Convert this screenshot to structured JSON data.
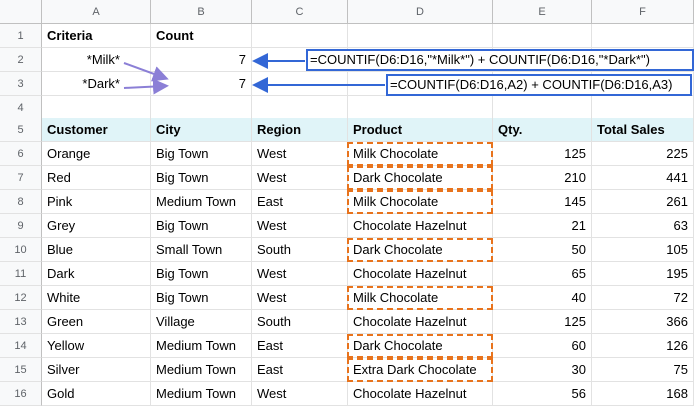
{
  "columns": [
    "A",
    "B",
    "C",
    "D",
    "E",
    "F"
  ],
  "rows": {
    "r1": {
      "num": "1",
      "a": "Criteria",
      "b": "Count"
    },
    "r2": {
      "num": "2",
      "a": "*Milk*",
      "b": "7"
    },
    "r3": {
      "num": "3",
      "a": "*Dark*",
      "b": "7"
    },
    "r4": {
      "num": "4"
    },
    "r5": {
      "num": "5",
      "a": "Customer",
      "b": "City",
      "c": "Region",
      "d": "Product",
      "e": "Qty.",
      "f": "Total Sales"
    },
    "data": [
      {
        "num": "6",
        "a": "Orange",
        "b": "Big Town",
        "c": "West",
        "d": "Milk Chocolate",
        "e": "125",
        "f": "225"
      },
      {
        "num": "7",
        "a": "Red",
        "b": "Big Town",
        "c": "West",
        "d": "Dark Chocolate",
        "e": "210",
        "f": "441"
      },
      {
        "num": "8",
        "a": "Pink",
        "b": "Medium Town",
        "c": "East",
        "d": "Milk Chocolate",
        "e": "145",
        "f": "261"
      },
      {
        "num": "9",
        "a": "Grey",
        "b": "Big Town",
        "c": "West",
        "d": "Chocolate Hazelnut",
        "e": "21",
        "f": "63"
      },
      {
        "num": "10",
        "a": "Blue",
        "b": "Small Town",
        "c": "South",
        "d": "Dark Chocolate",
        "e": "50",
        "f": "105"
      },
      {
        "num": "11",
        "a": "Dark",
        "b": "Big Town",
        "c": "West",
        "d": "Chocolate Hazelnut",
        "e": "65",
        "f": "195"
      },
      {
        "num": "12",
        "a": "White",
        "b": "Big Town",
        "c": "West",
        "d": "Milk Chocolate",
        "e": "40",
        "f": "72"
      },
      {
        "num": "13",
        "a": "Green",
        "b": "Village",
        "c": "South",
        "d": "Chocolate Hazelnut",
        "e": "125",
        "f": "366"
      },
      {
        "num": "14",
        "a": "Yellow",
        "b": "Medium Town",
        "c": "East",
        "d": "Dark Chocolate",
        "e": "60",
        "f": "126"
      },
      {
        "num": "15",
        "a": "Silver",
        "b": "Medium Town",
        "c": "East",
        "d": "Extra Dark Chocolate",
        "e": "30",
        "f": "75"
      },
      {
        "num": "16",
        "a": "Gold",
        "b": "Medium Town",
        "c": "West",
        "d": "Chocolate Hazelnut",
        "e": "56",
        "f": "168"
      }
    ]
  },
  "formulas": {
    "milk": "=COUNTIF(D6:D16,\"*Milk*\") + COUNTIF(D6:D16,\"*Dark*\")",
    "dark": "=COUNTIF(D6:D16,A2) + COUNTIF(D6:D16,A3)"
  },
  "colors": {
    "highlight_border": "#e8731c",
    "formula_border": "#3367d6",
    "arrow_purple": "#8b7fd6",
    "header_fill": "#e0f4f8"
  }
}
